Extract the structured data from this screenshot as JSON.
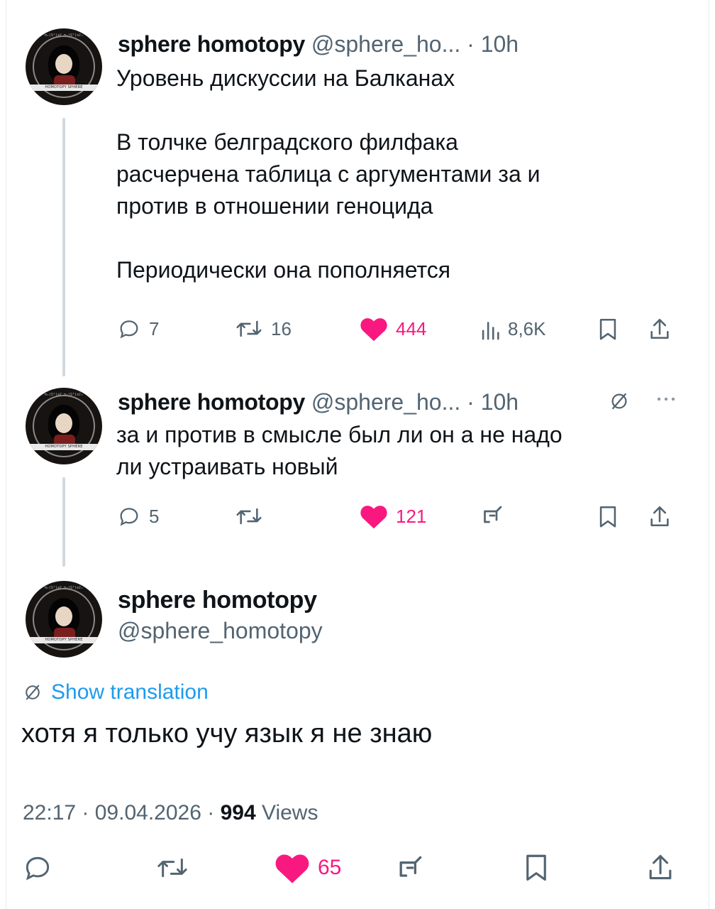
{
  "colors": {
    "text": "#0f1419",
    "secondary": "#536471",
    "like": "#f91880",
    "link": "#1d9bf0",
    "thread_line": "#cfd9de"
  },
  "avatar": {
    "band_text": "HOMOTOPY SPHERE",
    "formula_text": "π₃(S²)≅ℤ π₄(S³)≅ℤ₂"
  },
  "tweet1": {
    "name": "sphere homotopy",
    "handle": "@sphere_ho...",
    "time": "· 10h",
    "text": "Уровень дискуссии на Балканах\n\nВ толчке белградского филфака\nрасчерчена таблица с аргументами за и\nпротив в отношении геноцида\n\nПериодически она пополняется",
    "replies": "7",
    "retweets": "16",
    "likes": "444",
    "views": "8,6K",
    "icons": [
      "reply-icon",
      "retweet-icon",
      "like-heart-icon",
      "views-icon",
      "bookmark-icon",
      "share-icon"
    ]
  },
  "tweet2": {
    "name": "sphere homotopy",
    "handle": "@sphere_ho...",
    "time": "· 10h",
    "text": "за и против в смысле был ли он а не надо\nли устраивать новый",
    "replies": "5",
    "retweets": "",
    "likes": "121",
    "icons": [
      "translate-icon",
      "more-icon",
      "reply-icon",
      "retweet-icon",
      "like-heart-icon",
      "grok-icon",
      "bookmark-icon",
      "share-icon"
    ]
  },
  "tweet3": {
    "name": "sphere homotopy",
    "handle": "@sphere_homotopy",
    "show_translation": "Show translation",
    "text": "хотя я только учу язык я не знаю",
    "time": "22:17",
    "date": "09.04.2026",
    "views_count": "994",
    "views_label": "Views",
    "likes": "65",
    "icons": [
      "translate-icon",
      "reply-icon",
      "retweet-icon",
      "like-heart-icon",
      "grok-icon",
      "bookmark-icon",
      "share-icon"
    ]
  }
}
